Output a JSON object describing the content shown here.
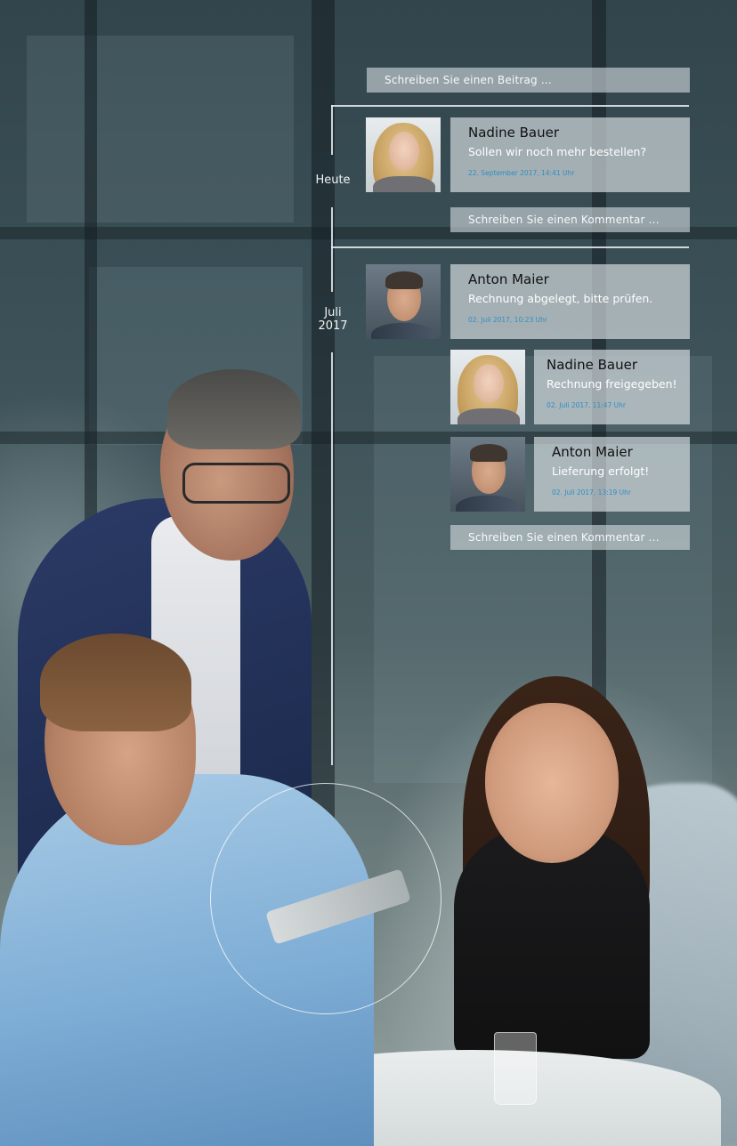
{
  "timeline": {
    "post_input_placeholder": "Schreiben Sie einen Beitrag ...",
    "groups": [
      {
        "date_label": "Heute",
        "posts": [
          {
            "author": "Nadine Bauer",
            "message": "Sollen wir noch mehr bestellen?",
            "timestamp": "22. September 2017, 14:41 Uhr"
          }
        ],
        "comment_input_placeholder": "Schreiben Sie einen Kommentar ..."
      },
      {
        "date_label_line1": "Juli",
        "date_label_line2": "2017",
        "posts": [
          {
            "author": "Anton Maier",
            "message": "Rechnung abgelegt, bitte prüfen.",
            "timestamp": "02. Juli 2017, 10:23 Uhr"
          }
        ],
        "replies": [
          {
            "author": "Nadine Bauer",
            "message": "Rechnung freigegeben!",
            "timestamp": "02. Juli 2017, 11:47 Uhr"
          },
          {
            "author": "Anton Maier",
            "message": "Lieferung erfolgt!",
            "timestamp": "02. Juli 2017, 13:19 Uhr"
          }
        ],
        "comment_input_placeholder": "Schreiben Sie einen Kommentar ..."
      }
    ]
  },
  "colors": {
    "timestamp_accent": "#2d8fc4",
    "card_background": "rgba(215,222,226,0.68)"
  }
}
